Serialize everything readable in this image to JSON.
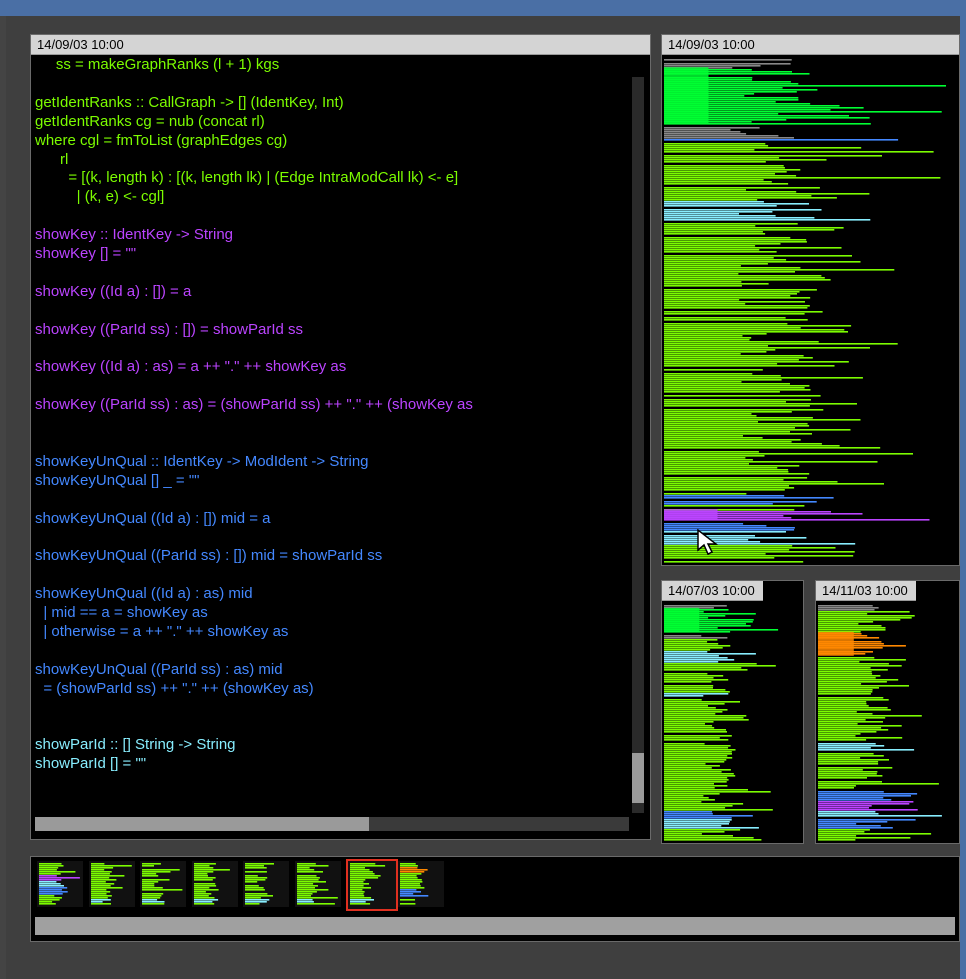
{
  "colors": {
    "green": "#7cfc00",
    "bright_green": "#00ff33",
    "magenta": "#bb44ff",
    "blue": "#4488ff",
    "cyan": "#88eeff",
    "orange": "#ff8800",
    "grey": "#888888"
  },
  "code_view": {
    "timestamp": "14/09/03 10:00",
    "lines": [
      {
        "text": "     ss = makeGraphRanks (l + 1) kgs",
        "color": "green"
      },
      {
        "text": "",
        "color": "green"
      },
      {
        "text": "getIdentRanks :: CallGraph -> [] (IdentKey, Int)",
        "color": "green"
      },
      {
        "text": "getIdentRanks cg = nub (concat rl)",
        "color": "green"
      },
      {
        "text": "where cgl = fmToList (graphEdges cg)",
        "color": "green"
      },
      {
        "text": "      rl",
        "color": "green"
      },
      {
        "text": "        = [(k, length k) : [(k, length lk) | (Edge IntraModCall lk) <- e]",
        "color": "green"
      },
      {
        "text": "          | (k, e) <- cgl]",
        "color": "green"
      },
      {
        "text": "",
        "color": "green"
      },
      {
        "text": "showKey :: IdentKey -> String",
        "color": "magenta"
      },
      {
        "text": "showKey [] = \"\"",
        "color": "magenta"
      },
      {
        "text": "",
        "color": "magenta"
      },
      {
        "text": "showKey ((Id a) : []) = a",
        "color": "magenta"
      },
      {
        "text": "",
        "color": "magenta"
      },
      {
        "text": "showKey ((ParId ss) : []) = showParId ss",
        "color": "magenta"
      },
      {
        "text": "",
        "color": "magenta"
      },
      {
        "text": "showKey ((Id a) : as) = a ++ \".\" ++ showKey as",
        "color": "magenta"
      },
      {
        "text": "",
        "color": "magenta"
      },
      {
        "text": "showKey ((ParId ss) : as) = (showParId ss) ++ \".\" ++ (showKey as",
        "color": "magenta"
      },
      {
        "text": "",
        "color": "magenta"
      },
      {
        "text": "",
        "color": "magenta"
      },
      {
        "text": "showKeyUnQual :: IdentKey -> ModIdent -> String",
        "color": "blue"
      },
      {
        "text": "showKeyUnQual [] _ = \"\"",
        "color": "blue"
      },
      {
        "text": "",
        "color": "blue"
      },
      {
        "text": "showKeyUnQual ((Id a) : []) mid = a",
        "color": "blue"
      },
      {
        "text": "",
        "color": "blue"
      },
      {
        "text": "showKeyUnQual ((ParId ss) : []) mid = showParId ss",
        "color": "blue"
      },
      {
        "text": "",
        "color": "blue"
      },
      {
        "text": "showKeyUnQual ((Id a) : as) mid",
        "color": "blue"
      },
      {
        "text": "  | mid == a = showKey as",
        "color": "blue"
      },
      {
        "text": "  | otherwise = a ++ \".\" ++ showKey as",
        "color": "blue"
      },
      {
        "text": "",
        "color": "blue"
      },
      {
        "text": "showKeyUnQual ((ParId ss) : as) mid",
        "color": "blue"
      },
      {
        "text": "  = (showParId ss) ++ \".\" ++ (showKey as)",
        "color": "blue"
      },
      {
        "text": "",
        "color": "blue"
      },
      {
        "text": "",
        "color": "blue"
      },
      {
        "text": "showParId :: [] String -> String",
        "color": "cyan"
      },
      {
        "text": "showParId [] = \"\"",
        "color": "cyan"
      }
    ],
    "vertical_scroll_position": 0.92,
    "horizontal_scroll_fraction": 0.56
  },
  "overviews": [
    {
      "timestamp": "14/09/03 10:00"
    },
    {
      "timestamp": "14/07/03 10:00"
    },
    {
      "timestamp": "14/11/03 10:00"
    }
  ],
  "timeline": {
    "version_count": 8,
    "selected_index": 6
  }
}
